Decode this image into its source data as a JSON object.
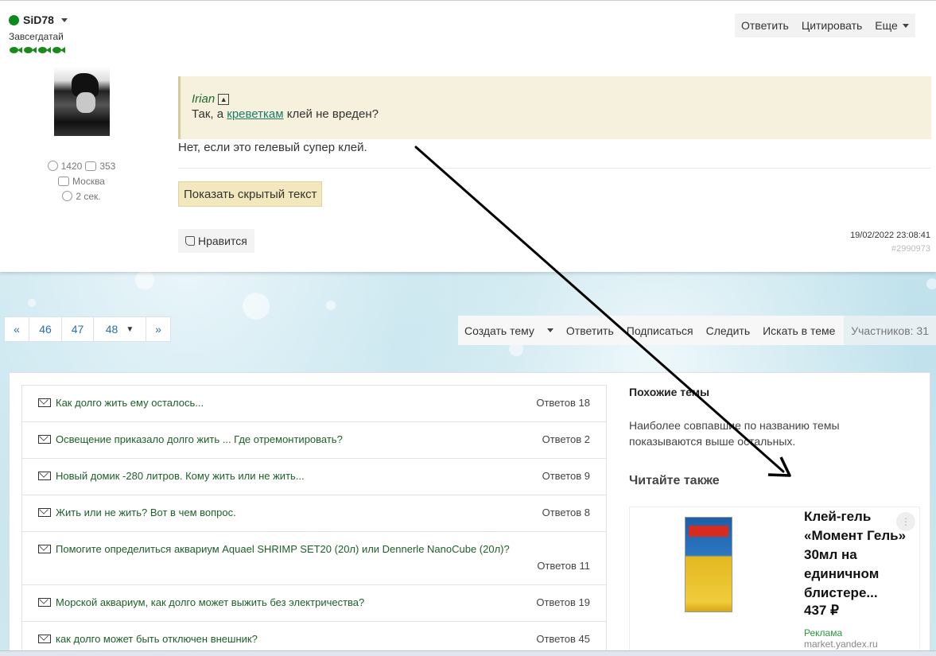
{
  "author": {
    "name": "SiD78",
    "rank": "Завсегдатай",
    "posts": "1420",
    "likes": "353",
    "city": "Москва",
    "last_seen": "2 сек."
  },
  "post_actions": {
    "reply": "Ответить",
    "quote": "Цитировать",
    "more": "Еще"
  },
  "quote": {
    "author": "Irian",
    "text_before": "Так, а ",
    "link": "креветкам",
    "text_after": " клей не вреден?"
  },
  "post": {
    "answer": "Нет, если это гелевый супер клей.",
    "spoiler": "Показать скрытый текст",
    "like": "Нравится",
    "date": "19/02/2022 23:08:41",
    "id": "#2990973"
  },
  "pager": {
    "prev": "«",
    "pages": [
      "46",
      "47"
    ],
    "current": "48",
    "next": "»"
  },
  "toolbar": {
    "create": "Создать тему",
    "reply": "Ответить",
    "subscribe": "Подписаться",
    "follow": "Следить",
    "search": "Искать в теме",
    "members": "Участников: 31"
  },
  "topics": [
    {
      "title": "Как долго жить ему осталось...",
      "replies": "Ответов 18"
    },
    {
      "title": "Освещение приказало долго жить ... Где отремонтировать?",
      "replies": "Ответов 2"
    },
    {
      "title": "Новый домик -280 литров. Кому жить или не жить...",
      "replies": "Ответов 9"
    },
    {
      "title": "Жить или не жить? Вот в чем вопрос.",
      "replies": "Ответов 8"
    },
    {
      "title": "Помогите определиться аквариум Aquael SHRIMP SET20 (20л) или Dennerle NanoCube (20л)?",
      "replies": "Ответов 11"
    },
    {
      "title": "Морской аквариум, как долго может выжить без электричества?",
      "replies": "Ответов 19"
    },
    {
      "title": "как долго может быть отключен внешник?",
      "replies": "Ответов 45"
    }
  ],
  "sidebar": {
    "similar_title": "Похожие темы",
    "similar_text": "Наиболее совпавшие по названию темы показываются выше остальных.",
    "read_also": "Читайте также"
  },
  "ad": {
    "title": "Клей-гель «Момент Гель» 30мл на единичном блистере...",
    "price": "437 ₽",
    "label": "Реклама",
    "domain": "market.yandex.ru"
  },
  "colors": {
    "online": "#0c8a1e",
    "link_green": "#1e5e2a",
    "quote_bg": "#f5f1dc",
    "spoiler_bg": "#f3e8bd",
    "pager_link": "#2a6fb0"
  }
}
